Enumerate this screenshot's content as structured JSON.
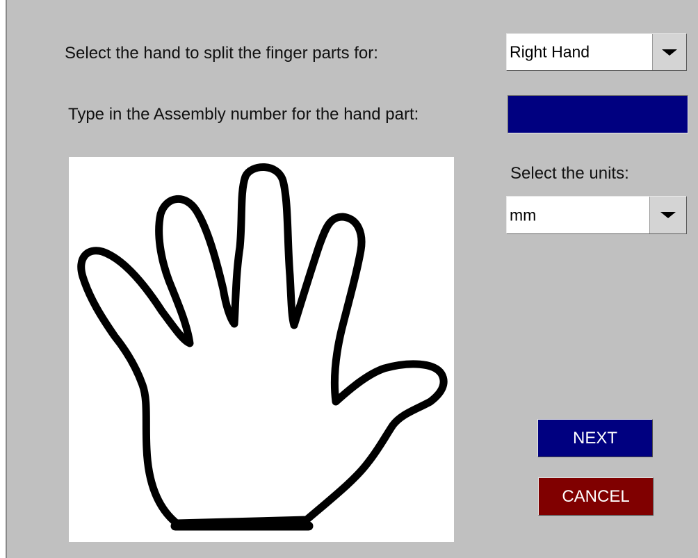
{
  "colors": {
    "dialog_bg": "#c0c0c0",
    "field_bg": "#000080",
    "next_bg": "#000080",
    "cancel_bg": "#800000"
  },
  "hand_selection": {
    "label": "Select the hand to split the finger parts for:",
    "selected": "Right Hand",
    "dropdown_icon": "chevron-down-icon"
  },
  "assembly": {
    "label": "Type in the Assembly number for the hand part:",
    "value": ""
  },
  "units": {
    "label": "Select the units:",
    "selected": "mm",
    "dropdown_icon": "chevron-down-icon"
  },
  "image": {
    "icon": "hand-outline-icon"
  },
  "buttons": {
    "next_label": "NEXT",
    "cancel_label": "CANCEL"
  }
}
